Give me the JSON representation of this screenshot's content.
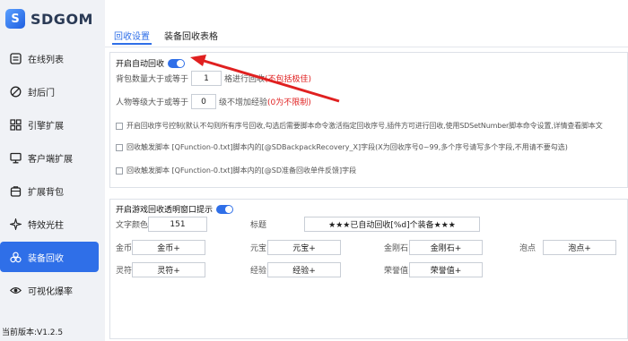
{
  "app": {
    "logo_letter": "S",
    "logo_text": "SDGOM",
    "version": "当前版本:V1.2.5"
  },
  "sidebar": {
    "items": [
      {
        "label": "在线列表",
        "icon": "list-icon"
      },
      {
        "label": "封后门",
        "icon": "block-icon"
      },
      {
        "label": "引擎扩展",
        "icon": "grid-icon"
      },
      {
        "label": "客户端扩展",
        "icon": "monitor-icon"
      },
      {
        "label": "扩展背包",
        "icon": "bag-icon"
      },
      {
        "label": "特效光柱",
        "icon": "sparkle-icon"
      },
      {
        "label": "装备回收",
        "icon": "recycle-icon",
        "active": true
      },
      {
        "label": "可视化爆率",
        "icon": "eye-icon"
      }
    ]
  },
  "tabs": [
    {
      "label": "回收设置",
      "active": true
    },
    {
      "label": "装备回收表格"
    }
  ],
  "recycle": {
    "enable_label": "开启自动回收",
    "enabled": true,
    "bag_prefix": "背包数量大于或等于",
    "bag_value": "1",
    "bag_suffix": "格进行回收",
    "bag_note": "(不包括极佳)",
    "level_prefix": "人物等级大于或等于",
    "level_value": "0",
    "level_suffix": "级不增加经验",
    "level_note": "(0为不限制)",
    "opt1": "开启回收序号控制(默认不勾则所有序号回收,勾选后需要脚本命令激活指定回收序号,插件方可进行回收,使用SDSetNumber脚本命令设置,详情查看脚本文",
    "opt2": "回收触发脚本 [QFunction-0.txt]脚本内的[@SDBackpackRecovery_X]字段(X为回收序号0~99,多个序号请写多个字段,不用请不要勾选)",
    "opt3": "回收触发脚本 [QFunction-0.txt]脚本内的[@SD准备回收单件反馈]字段"
  },
  "popup": {
    "enable_label": "开启游戏回收透明窗口提示",
    "enabled": true,
    "text_color_label": "文字颜色",
    "text_color_value": "151",
    "title_label": "标题",
    "title_value": "★★★已自动回收[%d]个装备★★★",
    "gold_label": "金币",
    "gold_value": "金币+",
    "yuanbao_label": "元宝",
    "yuanbao_value": "元宝+",
    "diamond_label": "金刚石",
    "diamond_value": "金刚石+",
    "points_label": "泡点",
    "points_value": "泡点+",
    "spirit_label": "灵符",
    "spirit_value": "灵符+",
    "exp_label": "经验",
    "exp_value": "经验+",
    "honor_label": "荣誉值",
    "honor_value": "荣誉值+"
  },
  "colors": {
    "accent": "#2f6fe8",
    "warning": "#e02222",
    "annotation_arrow": "#e02020"
  }
}
